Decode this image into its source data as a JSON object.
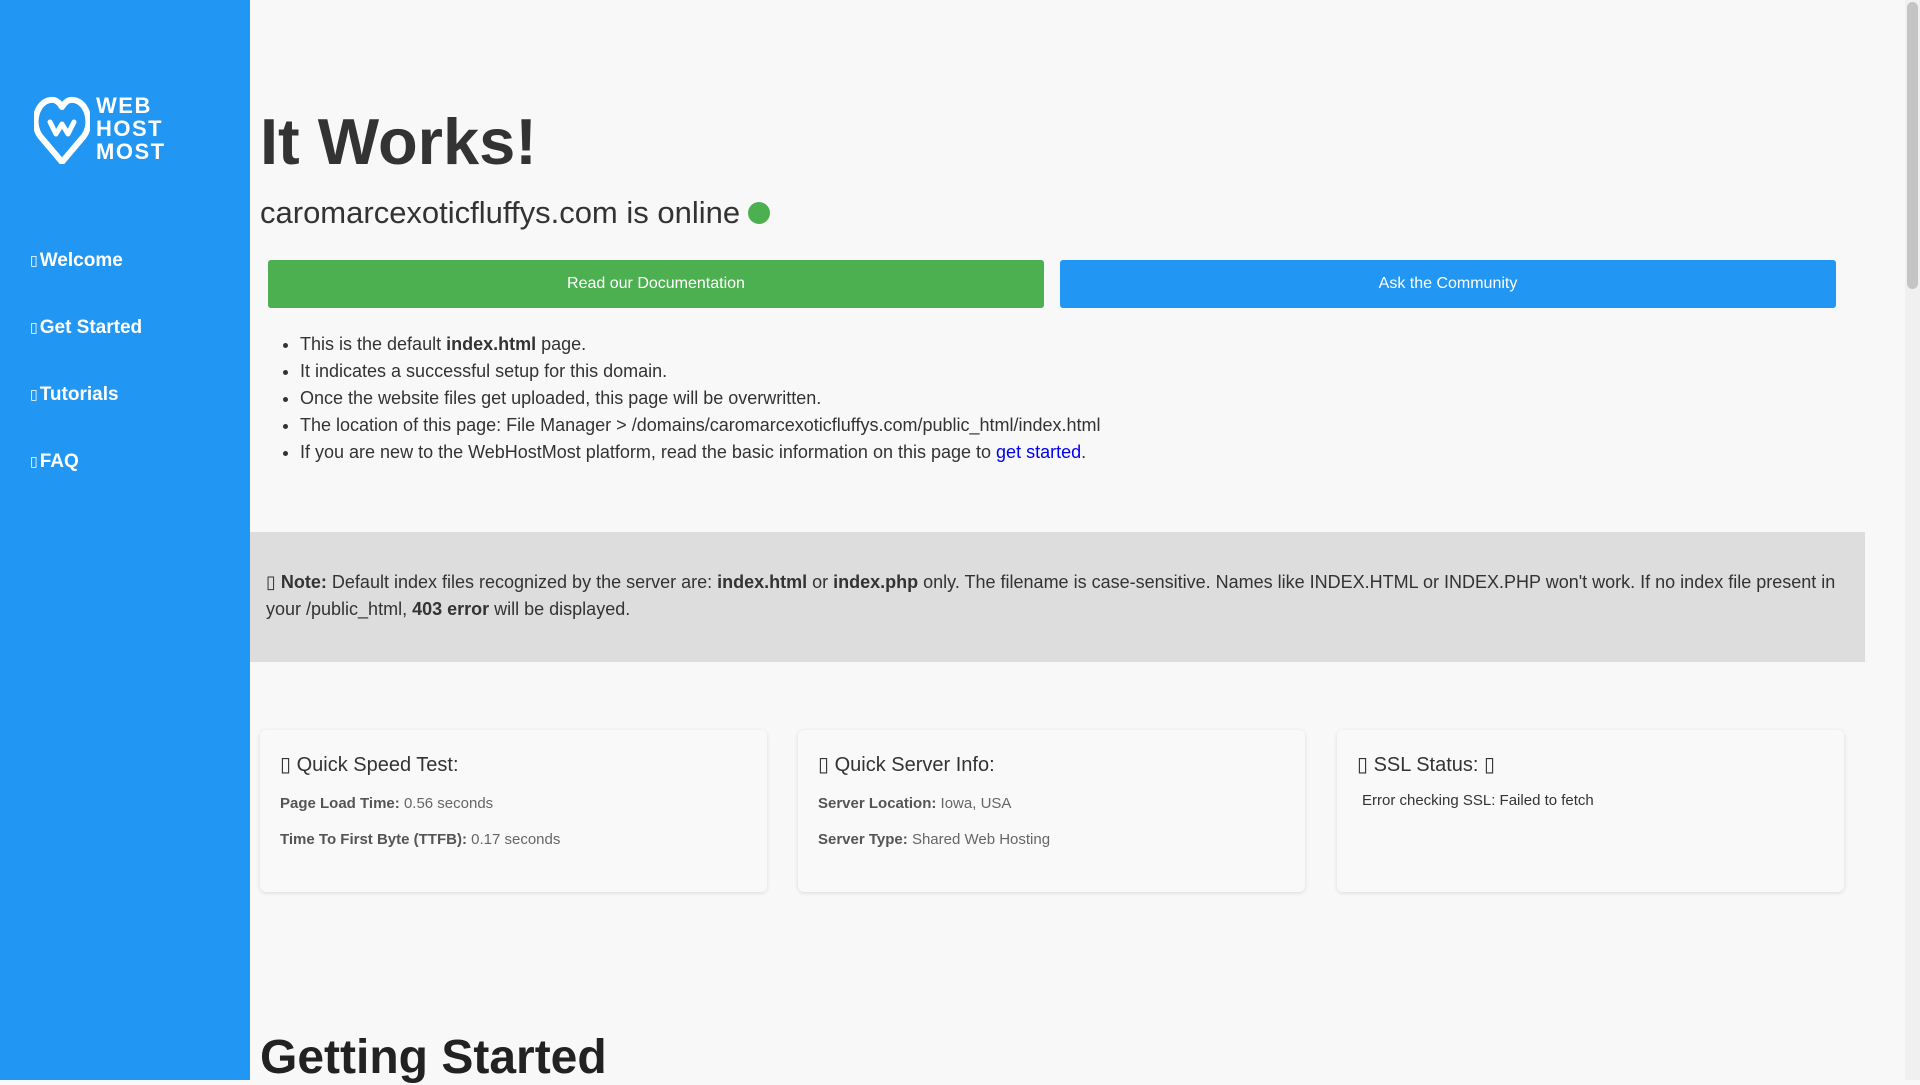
{
  "brand": {
    "logo_lines": [
      "WEB",
      "HOST",
      "MOST"
    ]
  },
  "sidebar": {
    "items": [
      {
        "label": "Welcome",
        "icon": "home-icon"
      },
      {
        "label": "Get Started",
        "icon": "rocket-icon"
      },
      {
        "label": "Tutorials",
        "icon": "book-icon"
      },
      {
        "label": "FAQ",
        "icon": "question-icon"
      }
    ]
  },
  "main": {
    "title": "It Works!",
    "online_text": "caromarcexoticfluffys.com is online",
    "buttons": {
      "docs": "Read our Documentation",
      "community": "Ask the Community"
    },
    "info": {
      "line1_pre": "This is the default ",
      "line1_bold": "index.html",
      "line1_post": " page.",
      "line2": "It indicates a successful setup for this domain.",
      "line3": "Once the website files get uploaded, this page will be overwritten.",
      "line4": "The location of this page: File Manager > /domains/caromarcexoticfluffys.com/public_html/index.html",
      "line5_pre": "If you are new to the WebHostMost platform, read the basic information on this page to ",
      "line5_link": "get started",
      "line5_post": "."
    },
    "note": {
      "label": "Note:",
      "t1": " Default index files recognized by the server are: ",
      "b1": "index.html",
      "t2": " or ",
      "b2": "index.php",
      "t3": " only. The filename is case-sensitive. Names like INDEX.HTML or INDEX.PHP won't work. If no index file present in your /public_html, ",
      "b3": "403 error",
      "t4": " will be displayed."
    },
    "cards": {
      "speed": {
        "title": "Quick Speed Test:",
        "plt_label": "Page Load Time:",
        "plt_value": "0.56 seconds",
        "ttfb_label": "Time To First Byte (TTFB):",
        "ttfb_value": "0.17 seconds"
      },
      "server": {
        "title": "Quick Server Info:",
        "loc_label": "Server Location:",
        "loc_value": "Iowa, USA",
        "type_label": "Server Type:",
        "type_value": "Shared Web Hosting"
      },
      "ssl": {
        "title": "SSL Status:",
        "message": "Error checking SSL: Failed to fetch"
      }
    },
    "section_heading": "Getting Started"
  },
  "colors": {
    "sidebar_bg": "#2196f3",
    "online_dot": "#4caf50",
    "docs_button": "#4caf50",
    "community_button": "#2196f3",
    "note_bg": "#dddddd"
  }
}
